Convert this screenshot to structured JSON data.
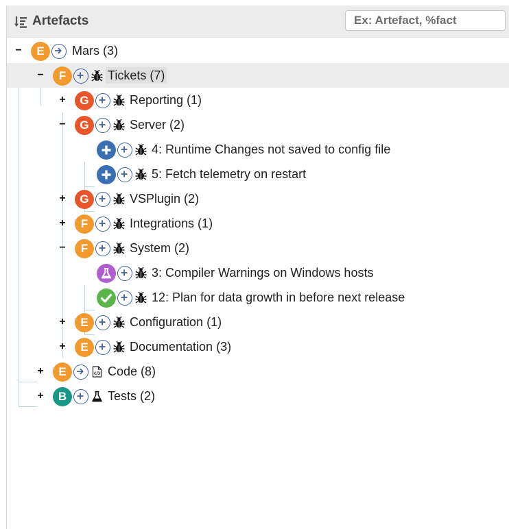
{
  "header": {
    "title": "Artefacts",
    "search_placeholder": "Ex: Artefact, %fact"
  },
  "tree": {
    "mars": {
      "toggle": "−",
      "badge": "E",
      "label": "Mars (3)"
    },
    "tickets": {
      "toggle": "−",
      "badge": "F",
      "label": "Tickets (7)",
      "selected": true
    },
    "reporting": {
      "toggle": "+",
      "badge": "G",
      "label": "Reporting (1)"
    },
    "server": {
      "toggle": "−",
      "badge": "G",
      "label": "Server (2)"
    },
    "ticket4": {
      "label": "4: Runtime Changes not saved to config file"
    },
    "ticket5": {
      "label": "5: Fetch telemetry on restart"
    },
    "vsplugin": {
      "toggle": "+",
      "badge": "G",
      "label": "VSPlugin (2)"
    },
    "integrations": {
      "toggle": "+",
      "badge": "F",
      "label": "Integrations (1)"
    },
    "system": {
      "toggle": "−",
      "badge": "F",
      "label": "System (2)"
    },
    "ticket3": {
      "label": "3: Compiler Warnings on Windows hosts"
    },
    "ticket12": {
      "label": "12: Plan for data growth in before next release"
    },
    "configuration": {
      "toggle": "+",
      "badge": "E",
      "label": "Configuration (1)"
    },
    "documentation": {
      "toggle": "+",
      "badge": "E",
      "label": "Documentation (3)"
    },
    "code": {
      "toggle": "+",
      "badge": "E",
      "label": "Code (8)"
    },
    "tests": {
      "toggle": "+",
      "badge": "B",
      "label": "Tests (2)"
    }
  },
  "colors": {
    "badge_E": "#f29a2e",
    "badge_F": "#f29a2e",
    "badge_G": "#e8562c",
    "badge_B": "#189987",
    "badge_blue": "#3a6fb3",
    "badge_purple": "#b15ed0",
    "badge_green": "#5bb54a",
    "action_ring": "#3c5f99",
    "tree_lines": "#b7d6e6"
  },
  "icons": {
    "sort": "sort-descending-icon",
    "action_plus": "add-circle-icon",
    "action_go": "navigate-circle-icon",
    "bug": "bug-icon",
    "code": "code-file-icon",
    "tests": "flask-icon",
    "ticket_blue": "plus-badge-icon",
    "ticket_purple": "flask-badge-icon",
    "ticket_green": "check-badge-icon"
  }
}
